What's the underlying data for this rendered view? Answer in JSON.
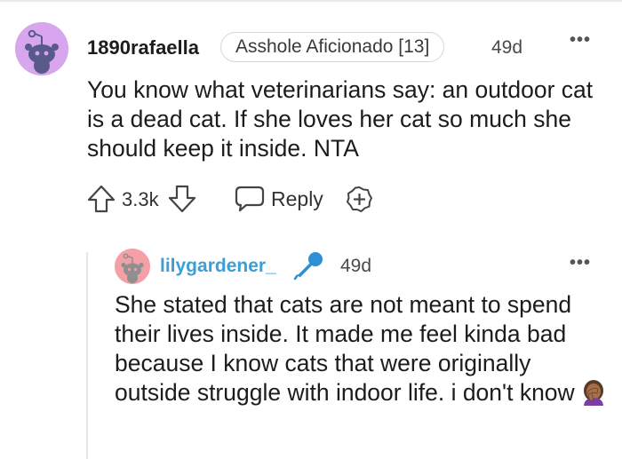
{
  "comment": {
    "username": "1890rafaella",
    "flair": "Asshole Aficionado [13]",
    "age": "49d",
    "body": "You know what veterinarians say: an outdoor cat is a dead cat. If she loves her cat so much she should keep it inside. NTA",
    "score": "3.3k",
    "reply_label": "Reply",
    "avatar_color": "#d7a6ee"
  },
  "reply": {
    "username": "lilygardener_",
    "age": "49d",
    "body": "She stated that cats are not meant to spend their lives inside. It made me feel kinda bad because I know cats that were originally outside struggle with indoor life. i don't know",
    "emoji": "person-facepalming",
    "avatar_color": "#f3a0a6",
    "username_color": "#3a9fd6"
  },
  "icons": {
    "more": "more-options-icon",
    "upvote": "upvote-arrow-icon",
    "downvote": "downvote-arrow-icon",
    "reply": "speech-bubble-icon",
    "award": "award-plus-icon",
    "mic": "microphone-icon"
  }
}
